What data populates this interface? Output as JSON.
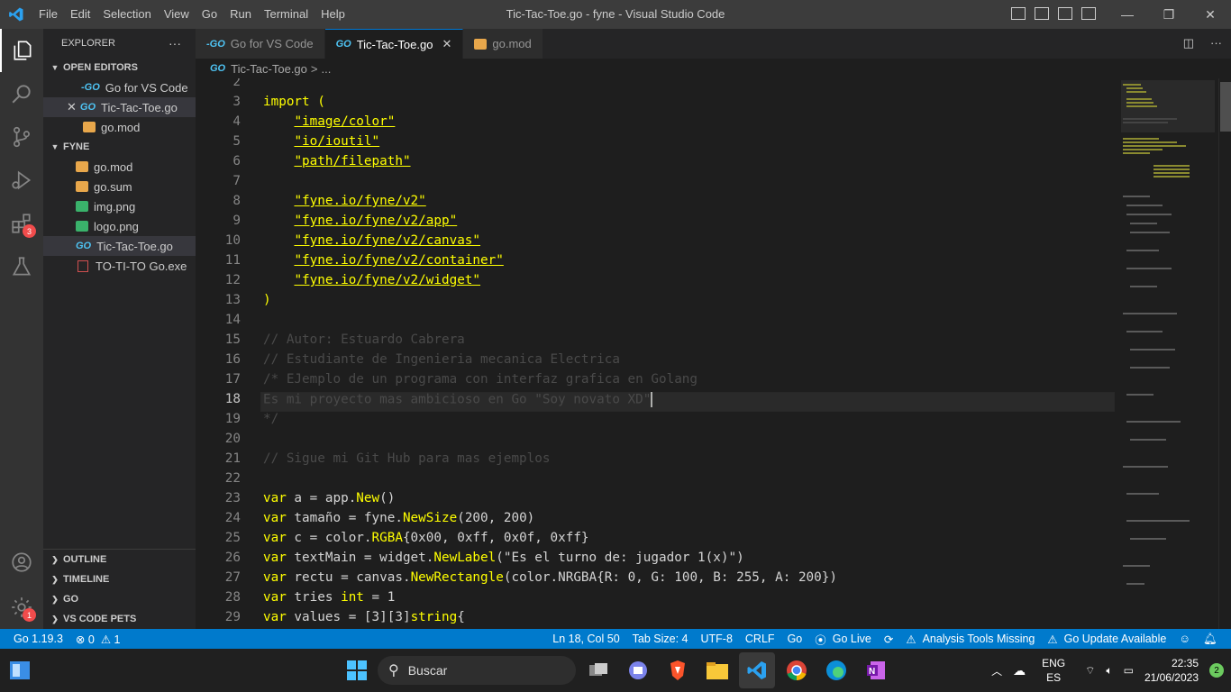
{
  "titlebar": {
    "menu": [
      "File",
      "Edit",
      "Selection",
      "View",
      "Go",
      "Run",
      "Terminal",
      "Help"
    ],
    "title": "Tic-Tac-Toe.go - fyne - Visual Studio Code",
    "minimize": "—",
    "restore": "❐",
    "close": "✕"
  },
  "activity": {
    "extensions_badge": "3",
    "settings_badge": "1"
  },
  "sidebar": {
    "title": "EXPLORER",
    "more": "···",
    "open_editors_label": "OPEN EDITORS",
    "open_editors": [
      {
        "label": "Go for VS Code",
        "icon": "go-icon"
      },
      {
        "label": "Tic-Tac-Toe.go",
        "icon": "go-icon"
      },
      {
        "label": "go.mod",
        "icon": "gomod-icon"
      }
    ],
    "folder_label": "FYNE",
    "files": [
      {
        "label": "go.mod"
      },
      {
        "label": "go.sum"
      },
      {
        "label": "img.png"
      },
      {
        "label": "logo.png"
      },
      {
        "label": "Tic-Tac-Toe.go"
      },
      {
        "label": "TO-TI-TO Go.exe"
      }
    ],
    "bottom_sections": [
      "OUTLINE",
      "TIMELINE",
      "GO",
      "VS CODE PETS"
    ]
  },
  "tabs": [
    {
      "label": "Go for VS Code"
    },
    {
      "label": "Tic-Tac-Toe.go",
      "close": "✕"
    },
    {
      "label": "go.mod"
    }
  ],
  "breadcrumb": {
    "file": "Tic-Tac-Toe.go",
    "sep": ">",
    "rest": "..."
  },
  "editor": {
    "line_numbers": [
      "2",
      "3",
      "4",
      "5",
      "6",
      "7",
      "8",
      "9",
      "10",
      "11",
      "12",
      "13",
      "14",
      "15",
      "16",
      "17",
      "18",
      "19",
      "20",
      "21",
      "22",
      "23",
      "24",
      "25",
      "26",
      "27",
      "28",
      "29"
    ],
    "current_line": "18",
    "lines": {
      "l3": "import",
      "l3b": " (",
      "l4": "\"image/color\"",
      "l5": "\"io/ioutil\"",
      "l6": "\"path/filepath\"",
      "l8": "\"fyne.io/fyne/v2\"",
      "l9": "\"fyne.io/fyne/v2/app\"",
      "l10": "\"fyne.io/fyne/v2/canvas\"",
      "l11": "\"fyne.io/fyne/v2/container\"",
      "l12": "\"fyne.io/fyne/v2/widget\"",
      "l13": ")",
      "l15": "// Autor: Estuardo Cabrera",
      "l16": "// Estudiante de Ingenieria mecanica Electrica",
      "l17": "/* EJemplo de un programa con interfaz grafica en Golang",
      "l18": "Es mi proyecto mas ambicioso en Go \"Soy novato XD\"",
      "l19": "*/",
      "l21": "// Sigue mi Git Hub para mas ejemplos",
      "l23a": "var",
      "l23b": " a = app.",
      "l23c": "New",
      "l23d": "()",
      "l24a": "var",
      "l24b": " tamaño = fyne.",
      "l24c": "NewSize",
      "l24d": "(200, 200)",
      "l25a": "var",
      "l25b": " c = color.",
      "l25c": "RGBA",
      "l25d": "{0x00, 0xff, 0x0f, 0xff}",
      "l26a": "var",
      "l26b": " textMain = widget.",
      "l26c": "NewLabel",
      "l26d": "(\"Es el turno de: jugador 1(x)\")",
      "l27a": "var",
      "l27b": " rectu = canvas.",
      "l27c": "NewRectangle",
      "l27d": "(color.NRGBA{R: 0, G: 100, B: 255, A: 200})",
      "l28a": "var",
      "l28b": " tries ",
      "l28c": "int",
      "l28d": " = 1",
      "l29a": "var",
      "l29b": " values = [3][3]",
      "l29c": "string",
      "l29d": "{"
    }
  },
  "status": {
    "go_version": "Go 1.19.3",
    "errors": "⊗ 0",
    "warnings": "⚠ 1",
    "position": "Ln 18, Col 50",
    "tab_size": "Tab Size: 4",
    "encoding": "UTF-8",
    "eol": "CRLF",
    "language": "Go",
    "go_live": "Go Live",
    "analysis": "Analysis Tools Missing",
    "update": "Go Update Available"
  },
  "taskbar": {
    "search_placeholder": "Buscar",
    "lang_top": "ENG",
    "lang_bottom": "ES",
    "time": "22:35",
    "date": "21/06/2023",
    "notif_count": "2"
  },
  "colors": {
    "accent": "#007acc",
    "string": "#ffff00",
    "comment": "#4a4a4a"
  }
}
